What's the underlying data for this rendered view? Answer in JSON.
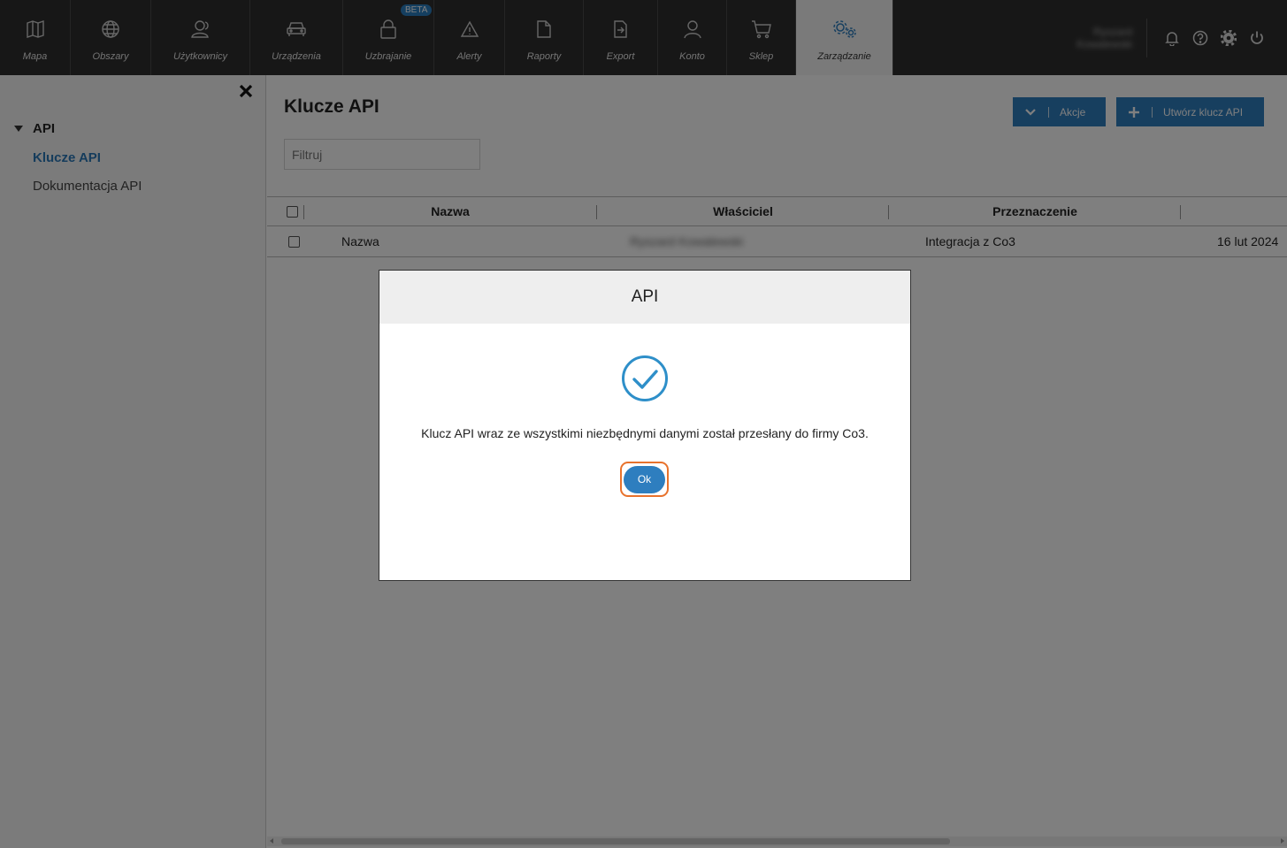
{
  "nav": {
    "items": [
      {
        "label": "Mapa",
        "icon": "map-icon"
      },
      {
        "label": "Obszary",
        "icon": "globe-icon"
      },
      {
        "label": "Użytkownicy",
        "icon": "users-icon"
      },
      {
        "label": "Urządzenia",
        "icon": "car-icon"
      },
      {
        "label": "Uzbrajanie",
        "icon": "lock-icon",
        "badge": "BETA"
      },
      {
        "label": "Alerty",
        "icon": "warning-icon"
      },
      {
        "label": "Raporty",
        "icon": "document-icon"
      },
      {
        "label": "Export",
        "icon": "export-icon"
      },
      {
        "label": "Konto",
        "icon": "account-icon"
      },
      {
        "label": "Sklep",
        "icon": "cart-icon"
      },
      {
        "label": "Zarządzanie",
        "icon": "gears-icon",
        "active": true
      }
    ],
    "user_name": "Ryszard Kowalewski"
  },
  "sidebar": {
    "group_label": "API",
    "links": [
      {
        "label": "Klucze API",
        "active": true
      },
      {
        "label": "Dokumentacja API",
        "active": false
      }
    ]
  },
  "main": {
    "title": "Klucze API",
    "actions_label": "Akcje",
    "create_label": "Utwórz klucz API",
    "filter_placeholder": "Filtruj",
    "columns": [
      "Nazwa",
      "Właściciel",
      "Przeznaczenie"
    ],
    "rows": [
      {
        "name": "Nazwa",
        "owner": "Ryszard Kowalewski",
        "purpose": "Integracja z Co3",
        "date": "16 lut 2024"
      }
    ]
  },
  "modal": {
    "title": "API",
    "message": "Klucz API wraz ze wszystkimi niezbędnymi danymi został przesłany do firmy Co3.",
    "ok_label": "Ok"
  },
  "colors": {
    "accent": "#2e7ebf",
    "topbar": "#2f2f2f",
    "focus_ring": "#e8722c"
  }
}
